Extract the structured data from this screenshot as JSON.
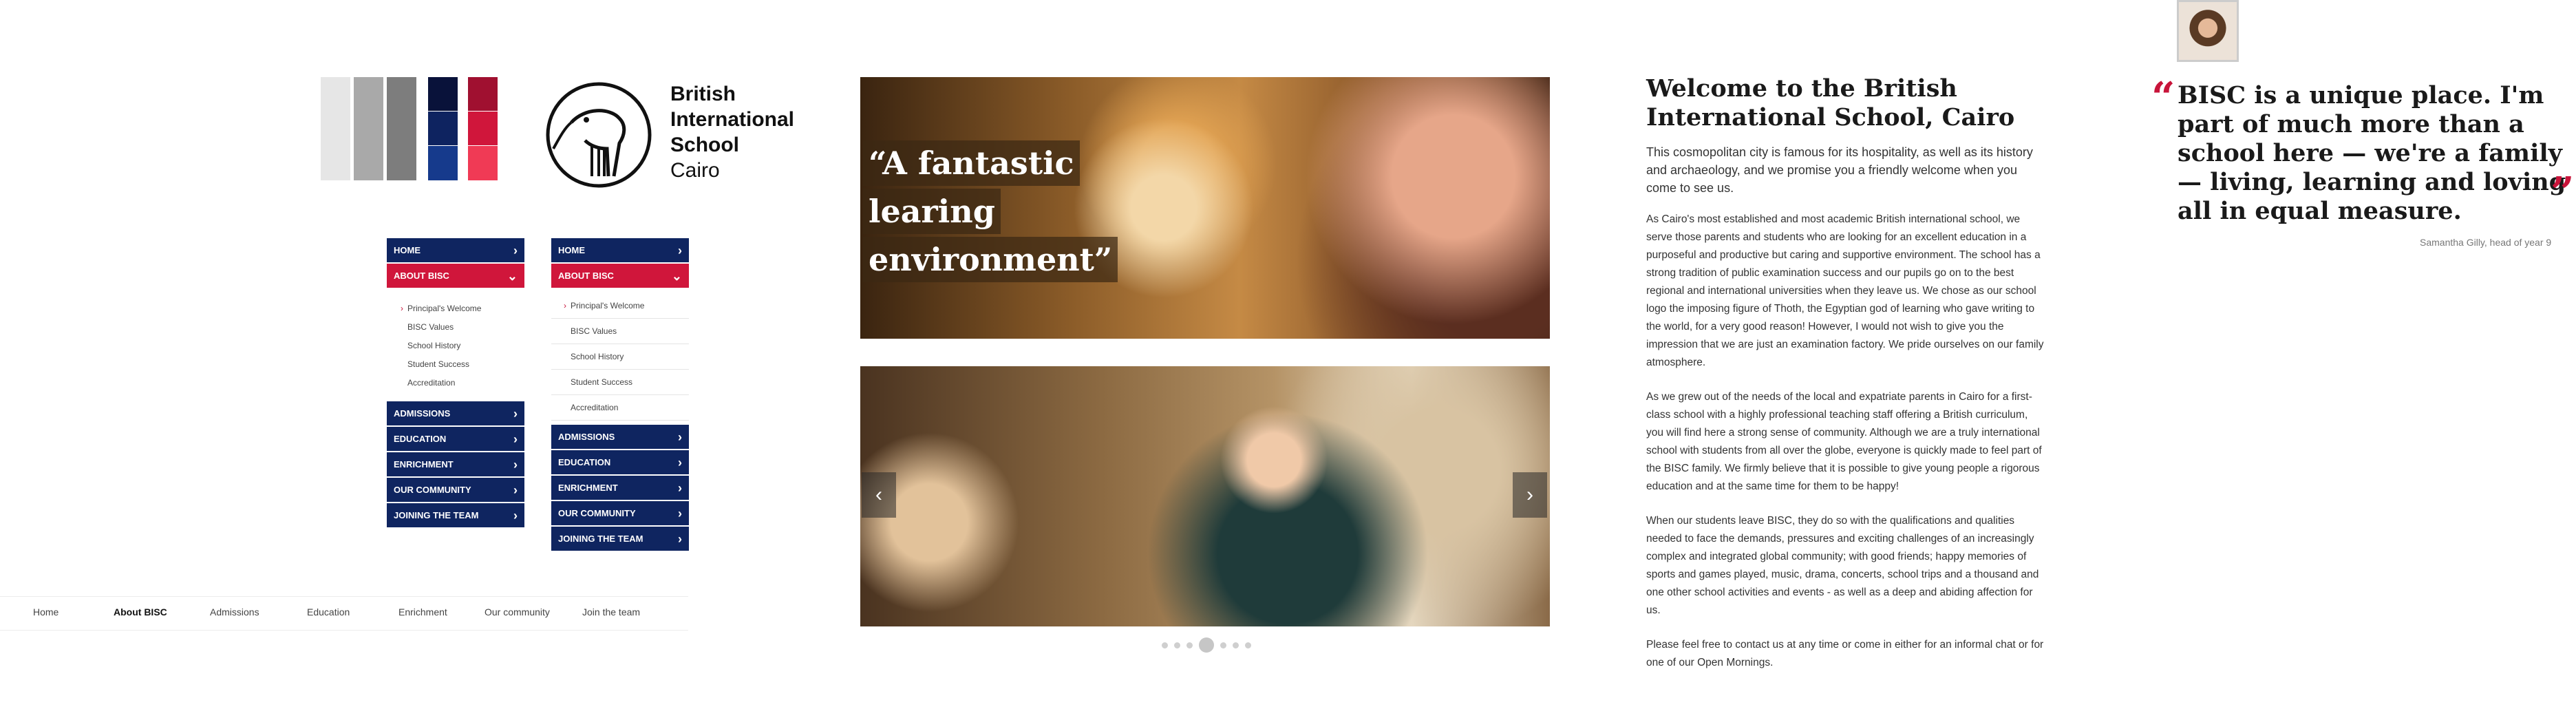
{
  "palette": {
    "grays": [
      "#e6e6e6",
      "#a9a9a9",
      "#7d7d7d"
    ],
    "navy": [
      "#09123a",
      "#0e2360",
      "#163a8c"
    ],
    "red": [
      "#a01030",
      "#d0163b",
      "#f03a55"
    ]
  },
  "logo": {
    "line1": "British",
    "line2": "International",
    "line3": "School",
    "line4": "Cairo",
    "icon": "ibis-bird-icon"
  },
  "side_nav": {
    "items": [
      "HOME",
      "ABOUT BISC",
      "ADMISSIONS",
      "EDUCATION",
      "ENRICHMENT",
      "OUR COMMUNITY",
      "JOINING THE TEAM"
    ],
    "active": "ABOUT BISC",
    "submenu": [
      "Principal's Welcome",
      "BISC Values",
      "School History",
      "Student Success",
      "Accreditation"
    ],
    "active_sub": "Principal's Welcome"
  },
  "bottom_nav": {
    "items": [
      "Home",
      "About BISC",
      "Admissions",
      "Education",
      "Enrichment",
      "Our community",
      "Join the team"
    ],
    "current": "About BISC"
  },
  "hero": {
    "quote_line1": "“A fantastic",
    "quote_line2": "learing",
    "quote_line3": "environment”"
  },
  "slider": {
    "prev_icon": "chevron-left-icon",
    "next_icon": "chevron-right-icon",
    "dots": 7,
    "active_dot": 4
  },
  "article": {
    "title": "Welcome to the British International School, Cairo",
    "lead": "This cosmopolitan city is famous for its hospitality, as well as its history and archaeology, and we promise you a friendly welcome when you come to see us.",
    "paragraphs": [
      "As Cairo's most established and most academic British international school, we serve those parents and students who are looking for an excellent education in a purposeful and productive but caring and supportive environment. The school has a strong tradition of public examination success and our pupils go on to the best regional and international universities when they leave us. We chose as our school logo the imposing figure of Thoth, the Egyptian god of learning who gave writing to the world, for a very good reason! However, I would not wish to give you the impression that we are just an examination factory. We pride ourselves on our family atmosphere.",
      "As we grew out of the needs of the local and expatriate parents in Cairo for a first-class school with a highly professional teaching staff offering a British curriculum, you will find here a strong sense of community. Although we are a truly international school with students from all over the globe, everyone is quickly made to feel part of the BISC family. We firmly believe that it is possible to give young people a rigorous education and at the same time for them to be happy!",
      "When our students leave BISC, they do so with the qualifications and qualities needed to face the demands, pressures and exciting challenges of an increasingly complex and integrated global community; with good friends; happy memories of sports and games played, music, drama, concerts, school trips and a thousand and one other school activities and events - as well as a deep and abiding affection for us.",
      "Please feel free to contact us at any time or come in either for an informal chat or for one of our Open Mornings."
    ]
  },
  "testimonial": {
    "open_mark": "“",
    "close_mark": "”",
    "quote": "BISC is a unique place. I'm part of much more than a school here — we're a family — living, learning and loving all in equal measure.",
    "attribution": "Samantha Gilly, head of year 9"
  }
}
